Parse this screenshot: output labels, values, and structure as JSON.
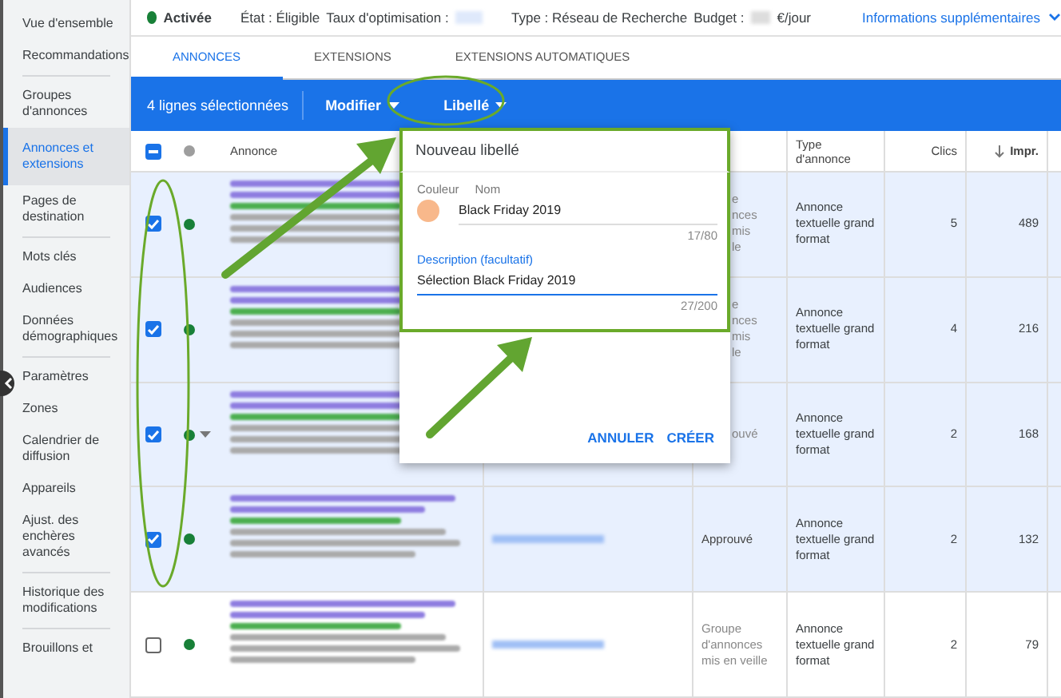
{
  "sidebar": {
    "sections": [
      {
        "items": [
          {
            "label": "Vue d'ensemble",
            "selected": false
          },
          {
            "label": "Recommandations",
            "selected": false
          }
        ]
      },
      {
        "items": [
          {
            "label": "Groupes d'annonces",
            "selected": false
          },
          {
            "label": "Annonces et extensions",
            "selected": true
          },
          {
            "label": "Pages de destination",
            "selected": false
          }
        ]
      },
      {
        "items": [
          {
            "label": "Mots clés",
            "selected": false
          },
          {
            "label": "Audiences",
            "selected": false
          },
          {
            "label": "Données démographiques",
            "selected": false
          }
        ]
      },
      {
        "items": [
          {
            "label": "Paramètres",
            "selected": false
          },
          {
            "label": "Zones",
            "selected": false
          },
          {
            "label": "Calendrier de diffusion",
            "selected": false
          },
          {
            "label": "Appareils",
            "selected": false
          },
          {
            "label": "Ajust. des enchères avancés",
            "selected": false
          }
        ]
      },
      {
        "items": [
          {
            "label": "Historique des modifications",
            "selected": false
          }
        ]
      },
      {
        "items": [
          {
            "label": "Brouillons et",
            "selected": false
          }
        ]
      }
    ]
  },
  "status_bar": {
    "status": "Activée",
    "state": "État : Éligible",
    "optimization": "Taux d'optimisation :",
    "type": "Type : Réseau de Recherche",
    "budget_label": "Budget :",
    "budget_unit": "€/jour",
    "more": "Informations supplémentaires"
  },
  "tabs": [
    {
      "label": "ANNONCES",
      "selected": true
    },
    {
      "label": "EXTENSIONS",
      "selected": false
    },
    {
      "label": "EXTENSIONS AUTOMATIQUES",
      "selected": false
    }
  ],
  "action_bar": {
    "selection": "4 lignes sélectionnées",
    "buttons": [
      "Modifier",
      "Libellé"
    ]
  },
  "table": {
    "select_all_partial": true,
    "columns": [
      "Annonce",
      "Type d'annonce",
      "Clics",
      "Impr."
    ],
    "rows": [
      {
        "checked": true,
        "caret": false,
        "blurred_link": false,
        "status": [
          "e",
          "nces mis",
          "le"
        ],
        "status_cut": true,
        "type": "Annonce textuelle grand format",
        "clicks": "5",
        "impressions": "489"
      },
      {
        "checked": true,
        "caret": false,
        "blurred_link": false,
        "status": [
          "e",
          "nces mis",
          "le"
        ],
        "status_cut": true,
        "type": "Annonce textuelle grand format",
        "clicks": "4",
        "impressions": "216"
      },
      {
        "checked": true,
        "caret": true,
        "blurred_link": false,
        "status": [
          "ouvé"
        ],
        "status_cut": true,
        "type": "Annonce textuelle grand format",
        "clicks": "2",
        "impressions": "168"
      },
      {
        "checked": true,
        "caret": false,
        "blurred_link": true,
        "status": [
          "Approuvé"
        ],
        "status_cut": false,
        "type": "Annonce textuelle grand format",
        "clicks": "2",
        "impressions": "132"
      },
      {
        "checked": false,
        "caret": false,
        "blurred_link": true,
        "status": [
          "Groupe d'annonces mis en veille"
        ],
        "status_cut": false,
        "type": "Annonce textuelle grand format",
        "clicks": "2",
        "impressions": "79"
      }
    ]
  },
  "dialog": {
    "title": "Nouveau libellé",
    "color_label": "Couleur",
    "color": "#f8b88b",
    "name_label": "Nom",
    "name_value": "Black Friday 2019",
    "name_count": "17/80",
    "description_label": "Description (facultatif)",
    "description_value": "Sélection Black Friday 2019",
    "description_count": "27/200",
    "buttons": [
      "ANNULER",
      "CRÉER"
    ]
  }
}
